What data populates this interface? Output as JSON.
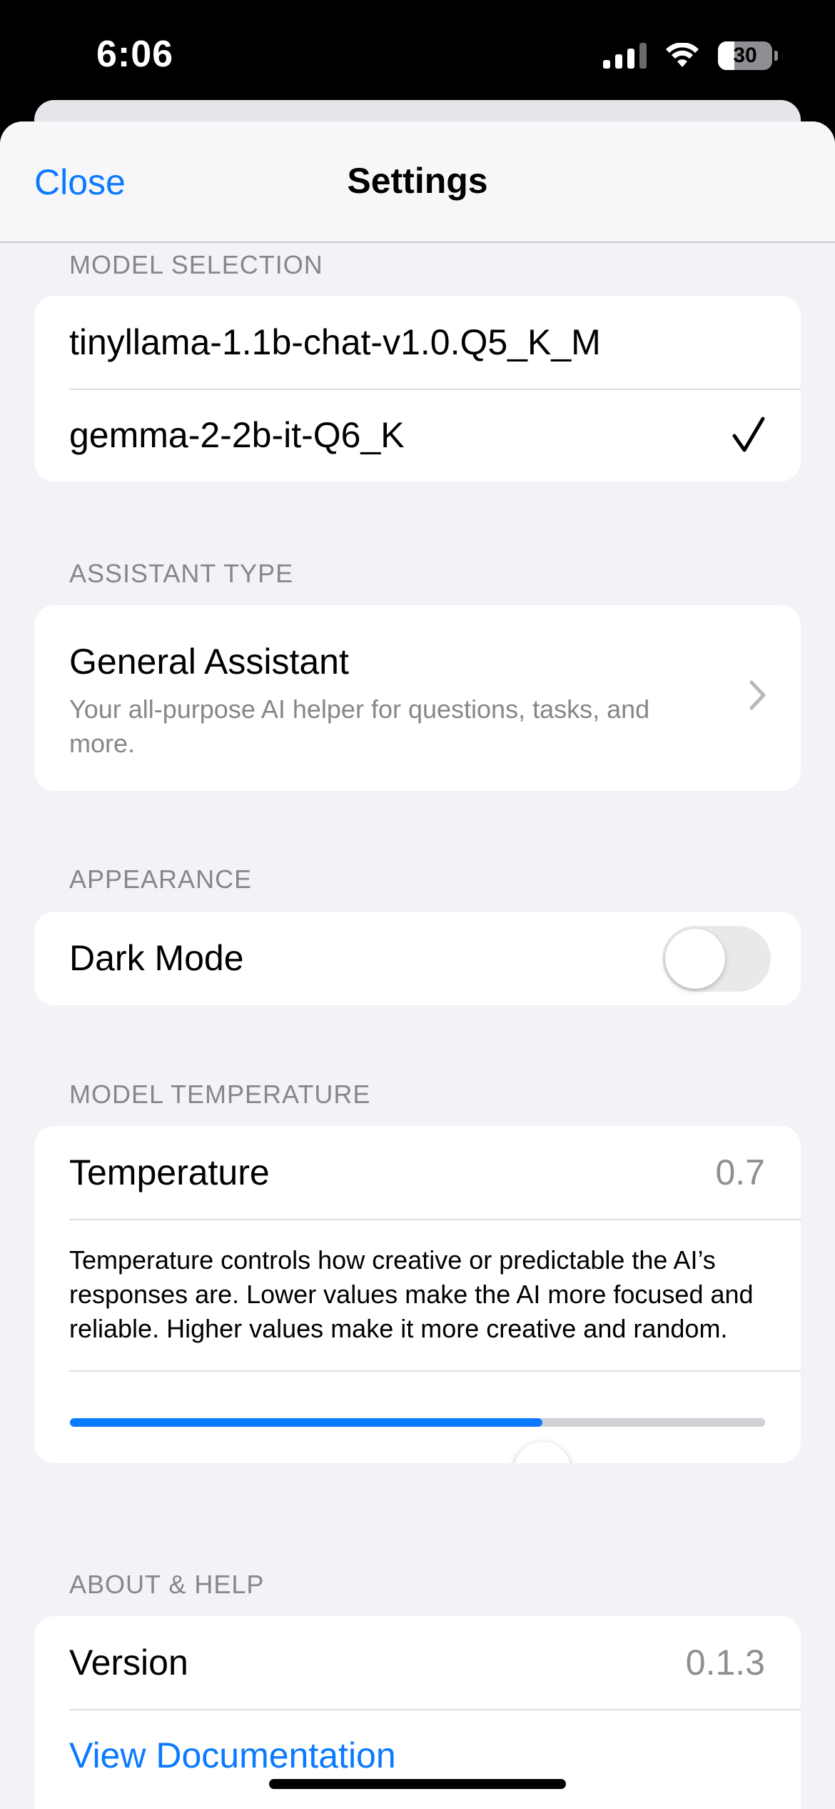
{
  "status_bar": {
    "time": "6:06",
    "battery_level": "30",
    "battery_fraction": 0.3
  },
  "nav": {
    "close_label": "Close",
    "title": "Settings"
  },
  "model_selection": {
    "header": "MODEL SELECTION",
    "models": [
      {
        "name": "tinyllama-1.1b-chat-v1.0.Q5_K_M",
        "selected": false
      },
      {
        "name": "gemma-2-2b-it-Q6_K",
        "selected": true
      }
    ]
  },
  "assistant_type": {
    "header": "ASSISTANT TYPE",
    "title": "General Assistant",
    "description": "Your all-purpose AI helper for questions, tasks, and more."
  },
  "appearance": {
    "header": "APPEARANCE",
    "dark_mode_label": "Dark Mode",
    "dark_mode_on": false
  },
  "model_temperature": {
    "header": "MODEL TEMPERATURE",
    "label": "Temperature",
    "value": "0.7",
    "description": "Temperature controls how creative or predictable the AI’s responses are. Lower values make the AI more focused and reliable. Higher values make it more creative and random.",
    "slider_fraction": 0.68
  },
  "about_help": {
    "header": "ABOUT & HELP",
    "version_label": "Version",
    "version_value": "0.1.3",
    "documentation_label": "View Documentation"
  },
  "colors": {
    "accent": "#0a7aff",
    "background": "#f2f2f7",
    "secondary_text": "#86868b"
  }
}
